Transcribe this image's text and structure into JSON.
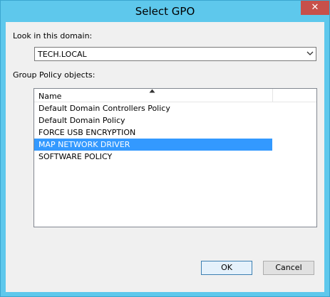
{
  "window": {
    "title": "Select GPO",
    "close_glyph": "✕"
  },
  "domain": {
    "label": "Look in this domain:",
    "value": "TECH.LOCAL"
  },
  "gpo_list": {
    "label": "Group Policy objects:",
    "column_header": "Name",
    "sort_direction": "ascending",
    "items": [
      {
        "name": "Default Domain Controllers Policy",
        "selected": false
      },
      {
        "name": "Default Domain Policy",
        "selected": false
      },
      {
        "name": "FORCE USB ENCRYPTION",
        "selected": false
      },
      {
        "name": "MAP NETWORK DRIVER",
        "selected": true
      },
      {
        "name": "SOFTWARE POLICY",
        "selected": false
      }
    ]
  },
  "buttons": {
    "ok": "OK",
    "cancel": "Cancel"
  },
  "colors": {
    "title_bar": "#5ec8ec",
    "close_button": "#c7504a",
    "selection": "#3399ff"
  }
}
